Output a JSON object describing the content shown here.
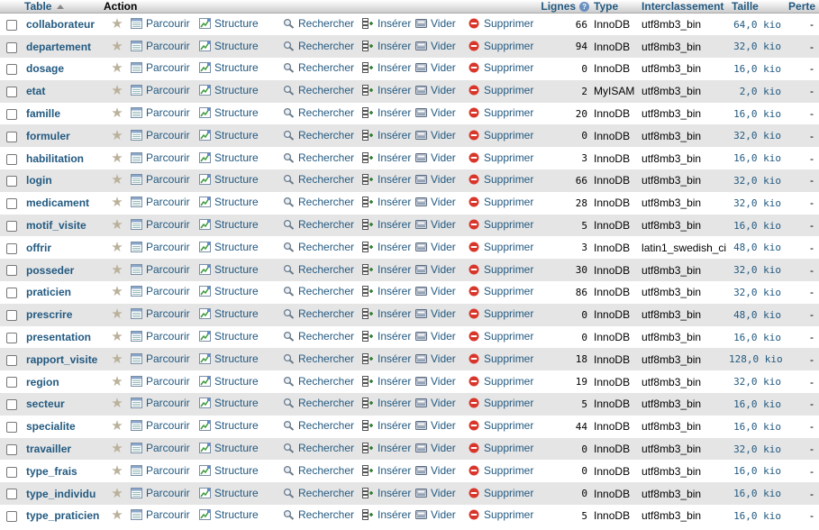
{
  "headers": {
    "table": "Table",
    "action": "Action",
    "lignes": "Lignes",
    "type": "Type",
    "interclassement": "Interclassement",
    "taille": "Taille",
    "perte": "Perte"
  },
  "actions": {
    "parcourir": "Parcourir",
    "structure": "Structure",
    "rechercher": "Rechercher",
    "inserer": "Insérer",
    "vider": "Vider",
    "supprimer": "Supprimer"
  },
  "rows": [
    {
      "name": "collaborateur",
      "rows": "66",
      "type": "InnoDB",
      "collation": "utf8mb3_bin",
      "size": "64,0 kio",
      "loss": "-"
    },
    {
      "name": "departement",
      "rows": "94",
      "type": "InnoDB",
      "collation": "utf8mb3_bin",
      "size": "32,0 kio",
      "loss": "-"
    },
    {
      "name": "dosage",
      "rows": "0",
      "type": "InnoDB",
      "collation": "utf8mb3_bin",
      "size": "16,0 kio",
      "loss": "-"
    },
    {
      "name": "etat",
      "rows": "2",
      "type": "MyISAM",
      "collation": "utf8mb3_bin",
      "size": "2,0 kio",
      "loss": "-"
    },
    {
      "name": "famille",
      "rows": "20",
      "type": "InnoDB",
      "collation": "utf8mb3_bin",
      "size": "16,0 kio",
      "loss": "-"
    },
    {
      "name": "formuler",
      "rows": "0",
      "type": "InnoDB",
      "collation": "utf8mb3_bin",
      "size": "32,0 kio",
      "loss": "-"
    },
    {
      "name": "habilitation",
      "rows": "3",
      "type": "InnoDB",
      "collation": "utf8mb3_bin",
      "size": "16,0 kio",
      "loss": "-"
    },
    {
      "name": "login",
      "rows": "66",
      "type": "InnoDB",
      "collation": "utf8mb3_bin",
      "size": "32,0 kio",
      "loss": "-"
    },
    {
      "name": "medicament",
      "rows": "28",
      "type": "InnoDB",
      "collation": "utf8mb3_bin",
      "size": "32,0 kio",
      "loss": "-"
    },
    {
      "name": "motif_visite",
      "rows": "5",
      "type": "InnoDB",
      "collation": "utf8mb3_bin",
      "size": "16,0 kio",
      "loss": "-"
    },
    {
      "name": "offrir",
      "rows": "3",
      "type": "InnoDB",
      "collation": "latin1_swedish_ci",
      "size": "48,0 kio",
      "loss": "-"
    },
    {
      "name": "posseder",
      "rows": "30",
      "type": "InnoDB",
      "collation": "utf8mb3_bin",
      "size": "32,0 kio",
      "loss": "-"
    },
    {
      "name": "praticien",
      "rows": "86",
      "type": "InnoDB",
      "collation": "utf8mb3_bin",
      "size": "32,0 kio",
      "loss": "-"
    },
    {
      "name": "prescrire",
      "rows": "0",
      "type": "InnoDB",
      "collation": "utf8mb3_bin",
      "size": "48,0 kio",
      "loss": "-"
    },
    {
      "name": "presentation",
      "rows": "0",
      "type": "InnoDB",
      "collation": "utf8mb3_bin",
      "size": "16,0 kio",
      "loss": "-"
    },
    {
      "name": "rapport_visite",
      "rows": "18",
      "type": "InnoDB",
      "collation": "utf8mb3_bin",
      "size": "128,0 kio",
      "loss": "-"
    },
    {
      "name": "region",
      "rows": "19",
      "type": "InnoDB",
      "collation": "utf8mb3_bin",
      "size": "32,0 kio",
      "loss": "-"
    },
    {
      "name": "secteur",
      "rows": "5",
      "type": "InnoDB",
      "collation": "utf8mb3_bin",
      "size": "16,0 kio",
      "loss": "-"
    },
    {
      "name": "specialite",
      "rows": "44",
      "type": "InnoDB",
      "collation": "utf8mb3_bin",
      "size": "16,0 kio",
      "loss": "-"
    },
    {
      "name": "travailler",
      "rows": "0",
      "type": "InnoDB",
      "collation": "utf8mb3_bin",
      "size": "32,0 kio",
      "loss": "-"
    },
    {
      "name": "type_frais",
      "rows": "0",
      "type": "InnoDB",
      "collation": "utf8mb3_bin",
      "size": "16,0 kio",
      "loss": "-"
    },
    {
      "name": "type_individu",
      "rows": "0",
      "type": "InnoDB",
      "collation": "utf8mb3_bin",
      "size": "16,0 kio",
      "loss": "-"
    },
    {
      "name": "type_praticien",
      "rows": "5",
      "type": "InnoDB",
      "collation": "utf8mb3_bin",
      "size": "16,0 kio",
      "loss": "-"
    }
  ],
  "icons": {
    "favorite": "star-icon",
    "browse": "browse-icon",
    "structure": "structure-icon",
    "search": "search-icon",
    "insert": "insert-icon",
    "empty": "empty-icon",
    "drop": "drop-icon"
  },
  "colors": {
    "link": "#235a81",
    "row_alt": "#e5e5e5",
    "drop_red": "#d9362b"
  }
}
